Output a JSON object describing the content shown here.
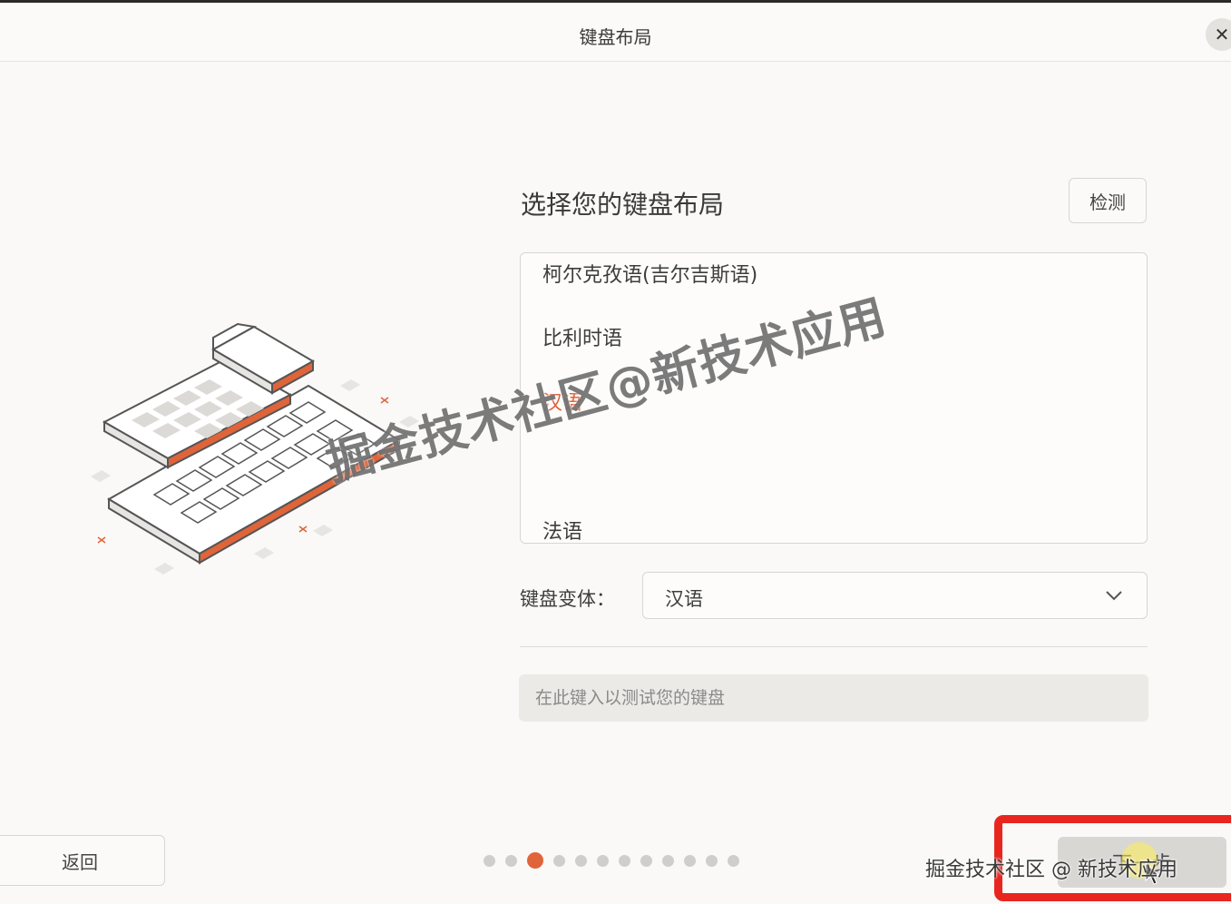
{
  "window": {
    "title": "键盘布局",
    "close_icon": "close-icon"
  },
  "page": {
    "heading": "选择您的键盘布局",
    "detect_label": "检测"
  },
  "layout_list": {
    "items": [
      {
        "label": "柯尔克孜语(吉尔吉斯语)",
        "selected": false
      },
      {
        "label": "比利时语",
        "selected": false
      },
      {
        "label": "汉语",
        "selected": true
      },
      {
        "label": "法语",
        "selected": false
      }
    ],
    "accent_color": "#e0643a"
  },
  "variant": {
    "label": "键盘变体：",
    "value": "汉语"
  },
  "test_input": {
    "placeholder": "在此键入以测试您的键盘",
    "value": ""
  },
  "footer": {
    "back_label": "返回",
    "next_label": "下一步",
    "progress": {
      "total_steps": 12,
      "current_step": 3
    }
  },
  "overlay": {
    "watermark_main": "掘金技术社区@新技术应用",
    "watermark_corner": "掘金技术社区 @ 新技术应用",
    "highlight_color": "#e8261f"
  }
}
